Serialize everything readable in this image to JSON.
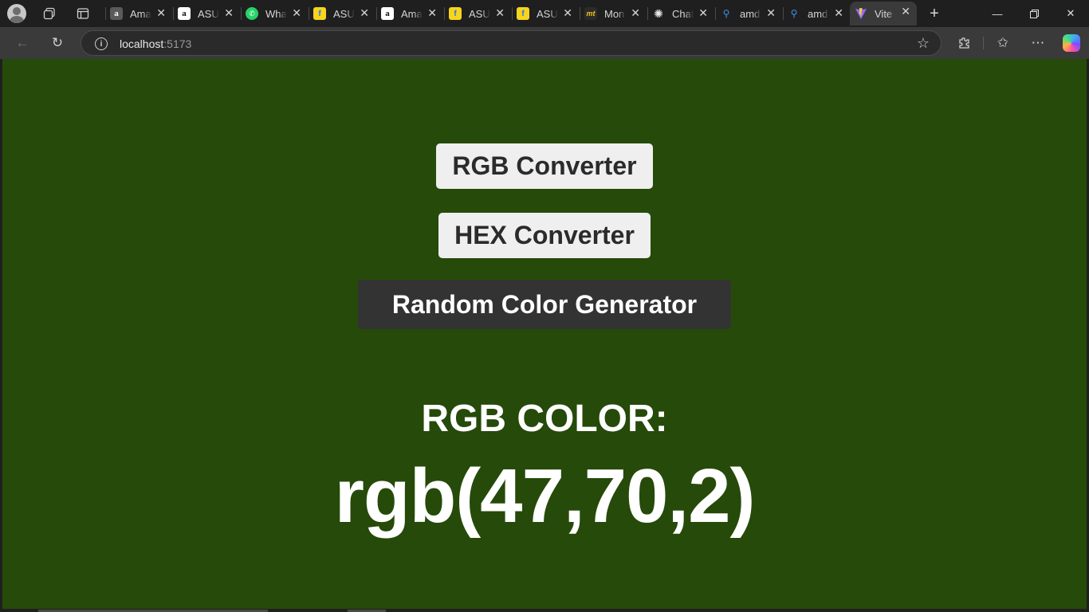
{
  "browser": {
    "tabs": [
      {
        "title": "Amazon",
        "favicon": "amazon-dark-icon"
      },
      {
        "title": "ASUS",
        "favicon": "amazon-icon"
      },
      {
        "title": "WhatsApp",
        "favicon": "whatsapp-icon"
      },
      {
        "title": "ASUS",
        "favicon": "flipkart-icon"
      },
      {
        "title": "Amazon",
        "favicon": "amazon-icon"
      },
      {
        "title": "ASUS",
        "favicon": "flipkart-icon"
      },
      {
        "title": "ASUS",
        "favicon": "flipkart-icon"
      },
      {
        "title": "Mon",
        "favicon": "moneycontrol-icon"
      },
      {
        "title": "Chat",
        "favicon": "chatgpt-icon"
      },
      {
        "title": "amd",
        "favicon": "search-icon"
      },
      {
        "title": "amd",
        "favicon": "search-icon"
      },
      {
        "title": "Vite",
        "favicon": "vite-icon",
        "active": true
      }
    ],
    "url_host": "localhost",
    "url_port": ":5173"
  },
  "page": {
    "background_color": "#264a09",
    "buttons": {
      "rgb": "RGB Converter",
      "hex": "HEX Converter",
      "random": "Random Color Generator"
    },
    "color_label": "RGB COLOR:",
    "color_value": "rgb(47,70,2)"
  }
}
